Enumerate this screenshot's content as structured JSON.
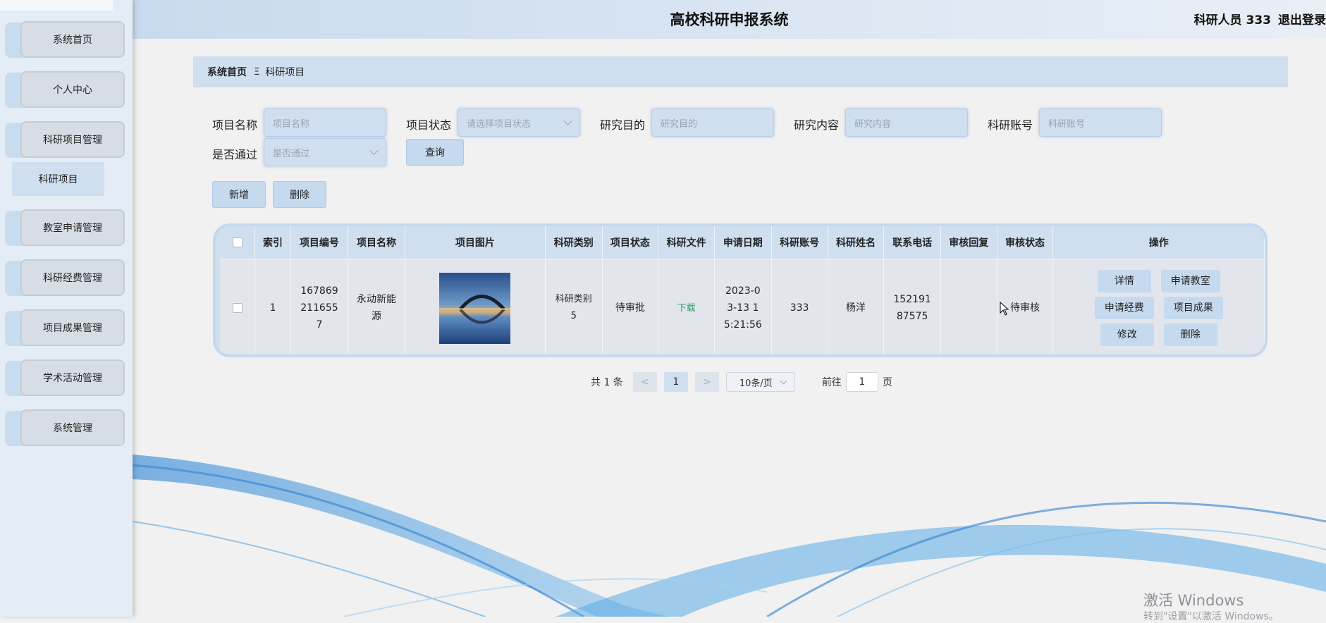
{
  "header": {
    "title": "高校科研申报系统",
    "user": "科研人员 333",
    "logout": "退出登录"
  },
  "sidebar": {
    "items": [
      {
        "label": "系统首页"
      },
      {
        "label": "个人中心"
      },
      {
        "label": "科研项目管理"
      },
      {
        "label": "教室申请管理"
      },
      {
        "label": "科研经费管理"
      },
      {
        "label": "项目成果管理"
      },
      {
        "label": "学术活动管理"
      },
      {
        "label": "系统管理"
      }
    ],
    "submenu": {
      "label": "科研项目"
    }
  },
  "breadcrumb": {
    "home": "系统首页",
    "separator": "Ξ",
    "current": "科研项目"
  },
  "search": {
    "project_name": {
      "label": "项目名称",
      "placeholder": "项目名称"
    },
    "project_status": {
      "label": "项目状态",
      "placeholder": "请选择项目状态"
    },
    "research_purpose": {
      "label": "研究目的",
      "placeholder": "研究目的"
    },
    "research_content": {
      "label": "研究内容",
      "placeholder": "研究内容"
    },
    "research_account": {
      "label": "科研账号",
      "placeholder": "科研账号"
    },
    "passed": {
      "label": "是否通过",
      "placeholder": "是否通过"
    },
    "query_button": "查询"
  },
  "actions": {
    "add": "新增",
    "delete": "删除"
  },
  "table": {
    "columns": [
      "索引",
      "项目编号",
      "项目名称",
      "项目图片",
      "科研类别",
      "项目状态",
      "科研文件",
      "申请日期",
      "科研账号",
      "科研姓名",
      "联系电话",
      "审核回复",
      "审核状态",
      "操作"
    ],
    "rows": [
      {
        "index": "1",
        "project_no": "1678692116557",
        "project_name": "永动新能源",
        "category": "科研类别5",
        "status": "待审批",
        "file": "下载",
        "apply_date": "2023-03-13 15:21:56",
        "account": "333",
        "name": "杨洋",
        "phone": "15219187575",
        "reply": "",
        "review_status": "待审核",
        "ops": {
          "detail": "详情",
          "apply_classroom": "申请教室",
          "apply_funding": "申请经费",
          "achievement": "项目成果",
          "edit": "修改",
          "delete": "删除"
        }
      }
    ]
  },
  "pagination": {
    "total": "共 1 条",
    "prev": "<",
    "current": "1",
    "next": ">",
    "page_size": "10条/页",
    "goto_prefix": "前往",
    "goto_value": "1",
    "goto_suffix": "页"
  },
  "watermark": {
    "line1": "激活 Windows",
    "line2": "转到\"设置\"以激活 Windows。"
  }
}
